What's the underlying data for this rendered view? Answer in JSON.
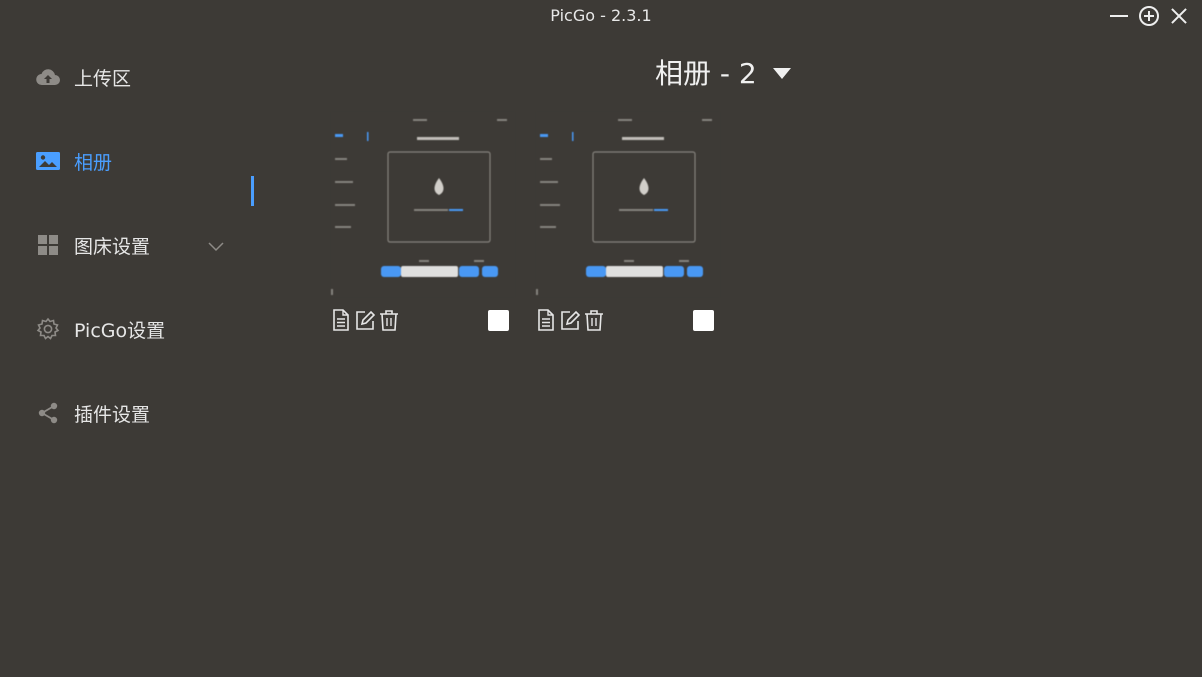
{
  "window": {
    "title": "PicGo - 2.3.1",
    "controls": [
      "minimize-icon",
      "maximize-icon",
      "close-icon"
    ]
  },
  "sidebar": {
    "items": [
      {
        "label": "上传区",
        "icon": "cloud-upload-icon",
        "active": false
      },
      {
        "label": "相册",
        "icon": "image-icon",
        "active": true
      },
      {
        "label": "图床设置",
        "icon": "grid-icon",
        "active": false,
        "expandable": true
      },
      {
        "label": "PicGo设置",
        "icon": "gear-icon",
        "active": false
      },
      {
        "label": "插件设置",
        "icon": "share-icon",
        "active": false
      }
    ],
    "info_icon": "info-icon"
  },
  "main": {
    "album_title": "相册 - 2"
  },
  "colors": {
    "background": "#3d3a36",
    "accent": "#4a9eff",
    "text": "#e6e6e6"
  }
}
